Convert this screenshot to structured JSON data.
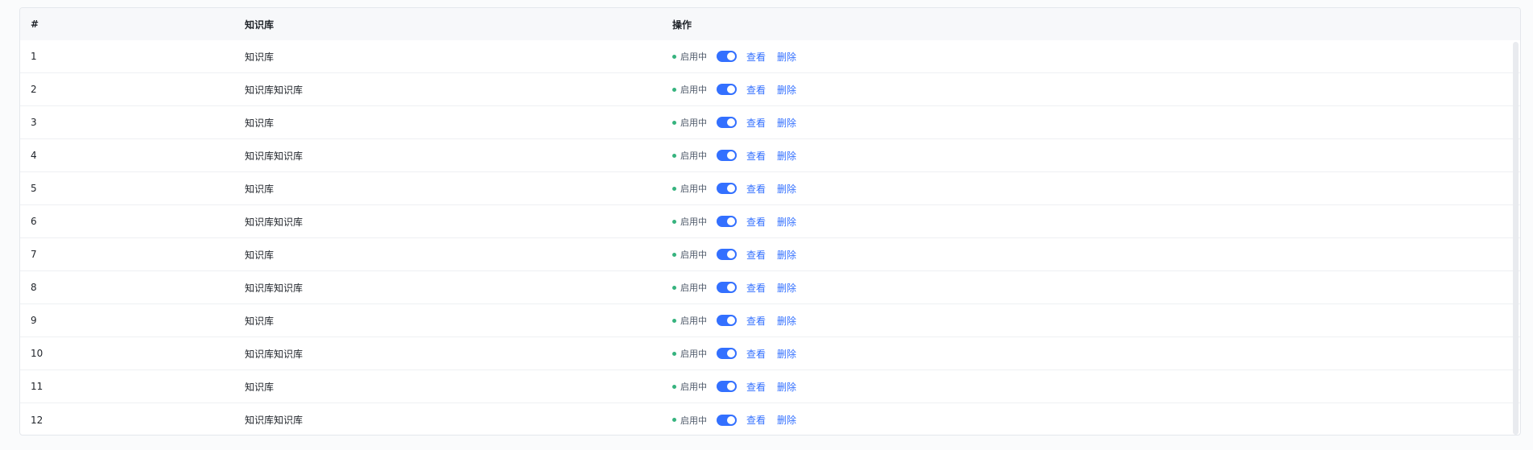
{
  "header": {
    "col_index": "#",
    "col_name": "知识库",
    "col_ops": "操作"
  },
  "ops": {
    "status": "启用中",
    "view": "查看",
    "delete": "删除"
  },
  "colors": {
    "accent": "#3370ff",
    "status_dot": "#36b37e"
  },
  "rows": [
    {
      "index": "1",
      "name": "知识库",
      "enabled": true
    },
    {
      "index": "2",
      "name": "知识库知识库",
      "enabled": true
    },
    {
      "index": "3",
      "name": "知识库",
      "enabled": true
    },
    {
      "index": "4",
      "name": "知识库知识库",
      "enabled": true
    },
    {
      "index": "5",
      "name": "知识库",
      "enabled": true
    },
    {
      "index": "6",
      "name": "知识库知识库",
      "enabled": true
    },
    {
      "index": "7",
      "name": "知识库",
      "enabled": true
    },
    {
      "index": "8",
      "name": "知识库知识库",
      "enabled": true
    },
    {
      "index": "9",
      "name": "知识库",
      "enabled": true
    },
    {
      "index": "10",
      "name": "知识库知识库",
      "enabled": true
    },
    {
      "index": "11",
      "name": "知识库",
      "enabled": true
    },
    {
      "index": "12",
      "name": "知识库知识库",
      "enabled": true
    }
  ]
}
